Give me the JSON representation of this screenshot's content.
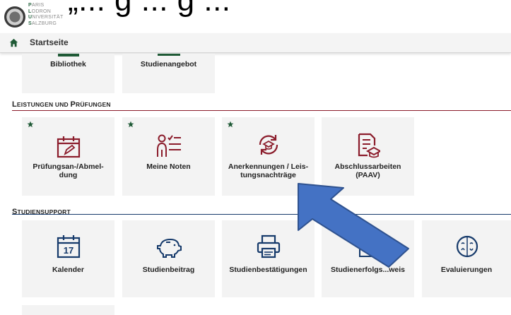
{
  "header": {
    "quote_fragment": "„... g ... g ... “",
    "logo_lines": [
      {
        "initial": "P",
        "rest": "ARIS"
      },
      {
        "initial": "L",
        "rest": "ODRON"
      },
      {
        "initial": "U",
        "rest": "NIVERSITÄT"
      },
      {
        "initial": "S",
        "rest": "ALZBURG"
      }
    ]
  },
  "nav": {
    "home_title": "Startseite"
  },
  "top_row": [
    {
      "label": "Bibliothek"
    },
    {
      "label": "Studienangebot"
    }
  ],
  "sections": {
    "leistungen": {
      "title": "Leistungen und Prüfungen",
      "accent": "#8b1c2b"
    },
    "studiensupport": {
      "title": "Studiensupport",
      "accent": "#163a6b"
    }
  },
  "leistungen_tiles": [
    {
      "label": "Prüfungsan-/Abmel-\ndung",
      "favorite": true,
      "icon": "calendar-edit-icon"
    },
    {
      "label": "Meine Noten",
      "favorite": true,
      "icon": "grades-list-icon"
    },
    {
      "label": "Anerkennungen / Leis-\ntungsnachträge",
      "favorite": true,
      "icon": "recognition-icon"
    },
    {
      "label": "Abschlussarbeiten\n(PAAV)",
      "favorite": false,
      "icon": "thesis-icon"
    }
  ],
  "support_tiles": [
    {
      "label": "Kalender",
      "icon": "calendar-icon",
      "calendar_day": "17"
    },
    {
      "label": "Studienbeitrag",
      "icon": "piggy-bank-icon"
    },
    {
      "label": "Studienbestätigungen",
      "icon": "printer-icon"
    },
    {
      "label": "Studienerfolgs...weis",
      "icon": "study-success-icon"
    },
    {
      "label": "Evaluierungen",
      "icon": "evaluation-icon"
    }
  ],
  "colors": {
    "accent_red": "#8b1c2b",
    "accent_blue": "#163a6b",
    "star_green": "#1f5a36",
    "arrow_fill": "#4472c4",
    "arrow_stroke": "#2f528f"
  }
}
